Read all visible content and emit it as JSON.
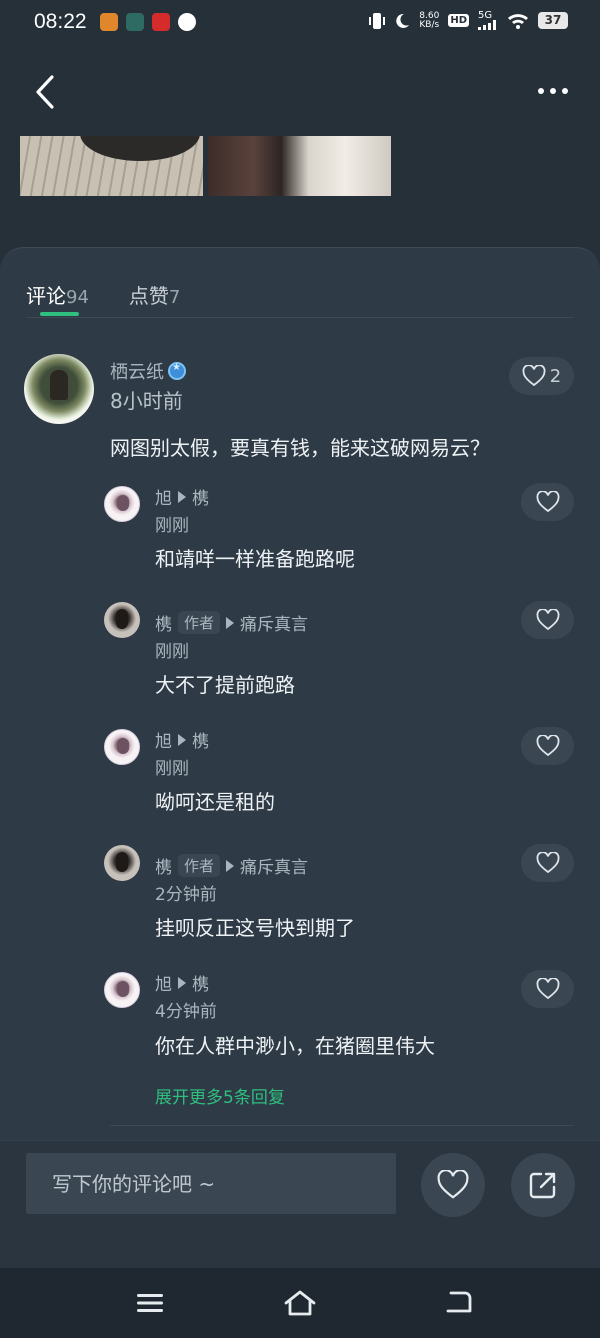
{
  "status_bar": {
    "time": "08:22",
    "net_speed": "8.60",
    "net_unit": "KB/s",
    "hd": "HD",
    "signal": "5G",
    "battery": "37"
  },
  "tabs": [
    {
      "label": "评论",
      "count": "94",
      "active": true
    },
    {
      "label": "点赞",
      "count": "7",
      "active": false
    }
  ],
  "main_comment": {
    "author": "栖云纸",
    "time": "8小时前",
    "content": "网图别太假，要真有钱，能来这破网易云？",
    "likes": "2"
  },
  "replies": [
    {
      "author": "旭",
      "reply_to": "槜",
      "author_tag": "",
      "time": "刚刚",
      "content": "和靖咩一样准备跑路呢"
    },
    {
      "author": "槜",
      "reply_to": "痛斥真言",
      "author_tag": "作者",
      "time": "刚刚",
      "content": "大不了提前跑路"
    },
    {
      "author": "旭",
      "reply_to": "槜",
      "author_tag": "",
      "time": "刚刚",
      "content": "呦呵还是租的"
    },
    {
      "author": "槜",
      "reply_to": "痛斥真言",
      "author_tag": "作者",
      "time": "2分钟前",
      "content": "挂呗反正这号快到期了"
    },
    {
      "author": "旭",
      "reply_to": "槜",
      "author_tag": "",
      "time": "4分钟前",
      "content": "你在人群中渺小，在猪圈里伟大"
    }
  ],
  "expand_replies": "展开更多5条回复",
  "input": {
    "placeholder": "写下你的评论吧 ~"
  },
  "colors": {
    "accent": "#2fbf7e",
    "background": "#253039",
    "panel": "#2e3a45"
  }
}
